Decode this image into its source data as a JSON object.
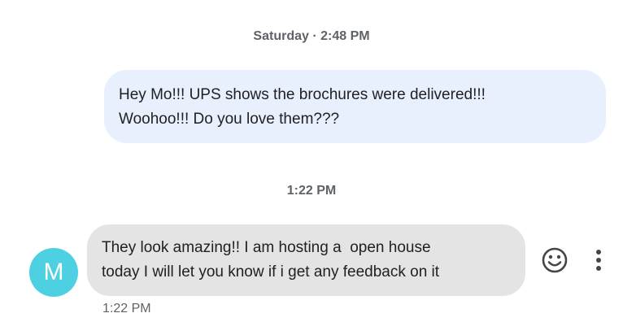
{
  "conversation": {
    "timestamp_1": "Saturday · 2:48 PM",
    "outgoing_message": {
      "line_1": "Hey Mo!!! UPS shows the brochures were delivered!!!",
      "line_2": "Woohoo!!! Do you love them???"
    },
    "timestamp_2": "1:22 PM",
    "incoming_message": {
      "avatar_letter": "M",
      "line_1": "They look amazing!! I am hosting a  open house",
      "line_2": "today I will let you know if i get any feedback on it",
      "time": "1:22 PM"
    }
  },
  "icons": {
    "reaction": "smiley-face-icon",
    "more": "more-vert-icon"
  },
  "colors": {
    "outgoing_bubble": "#e8effd",
    "incoming_bubble": "#e4e4e4",
    "avatar": "#4dd0e1",
    "meta_text": "#5f6368",
    "icon": "#444746"
  }
}
